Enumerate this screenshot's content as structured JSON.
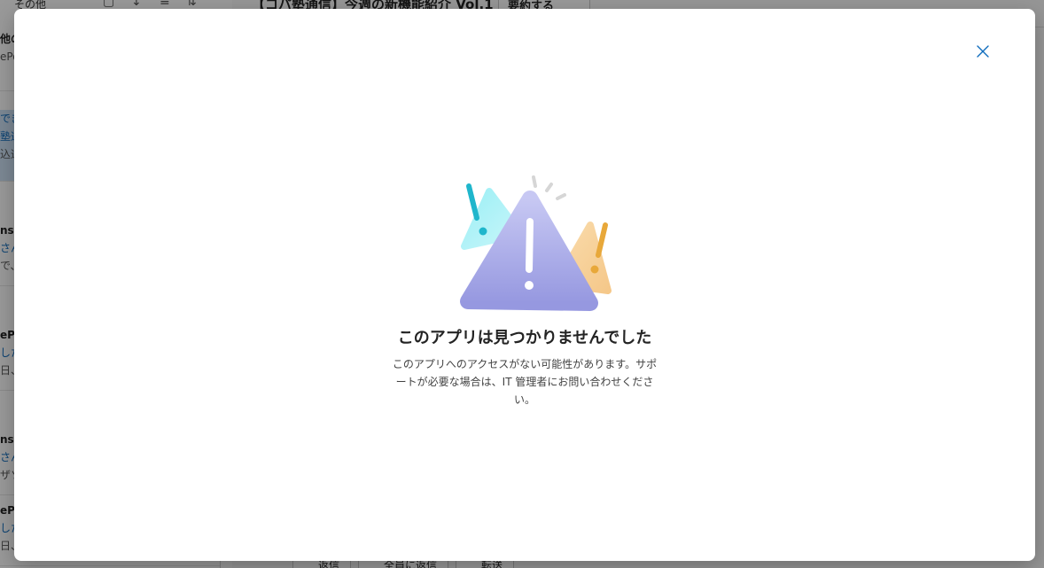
{
  "background": {
    "toolbar": {
      "other_label": "その他",
      "icons": [
        "checkbox-icon",
        "arrow-down-icon",
        "filter-icon",
        "sort-icon"
      ]
    },
    "email_subject": "【コパ塾通信】今週の新機能紹介 Vol.1",
    "summarize_label": "要約する",
    "list_items": [
      {
        "line1": "他の",
        "line2": "",
        "line3": "ePo"
      },
      {
        "line1": "でき",
        "line2": "塾通",
        "line3": "込通"
      },
      {
        "line1": "ns P",
        "line2": "さん",
        "line3": "で、I"
      },
      {
        "line1": "ePo",
        "line2": "した",
        "line3": "日、"
      },
      {
        "line1": "ns P",
        "line2": "さん",
        "line3": "ザソ"
      },
      {
        "line1": "ePo",
        "line2": "した",
        "line3": "日、"
      }
    ],
    "bottom_buttons": [
      "返信",
      "全員に返信",
      "転送"
    ]
  },
  "dialog": {
    "close_icon": "close-icon",
    "illustration": "warning-triangle-illustration",
    "title": "このアプリは見つかりませんでした",
    "message": "このアプリへのアクセスがない可能性があります。サポートが必要な場合は、IT 管理者にお問い合わせください。"
  },
  "colors": {
    "accent": "#0f6cbd",
    "overlay": "#000000",
    "warning_main": "#a4a6e8",
    "warning_left": "#7fe3ec",
    "warning_right": "#f7cf94",
    "exclaim_cyan": "#1fb6cc",
    "exclaim_orange": "#e8a83a"
  }
}
